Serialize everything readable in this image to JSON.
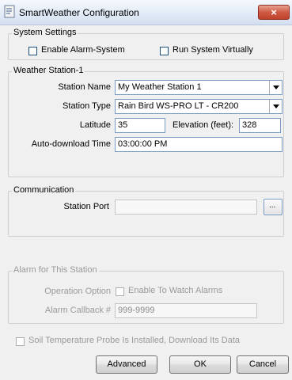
{
  "window": {
    "title": "SmartWeather Configuration",
    "close_icon": "×"
  },
  "system_settings": {
    "legend": "System Settings",
    "enable_alarm_system": {
      "label": "Enable Alarm-System",
      "checked": false
    },
    "run_virtually": {
      "label": "Run System Virtually",
      "checked": false
    }
  },
  "weather_station": {
    "legend": "Weather Station-1",
    "station_name_label": "Station Name",
    "station_name_value": "My Weather Station 1",
    "station_type_label": "Station Type",
    "station_type_value": "Rain Bird WS-PRO LT - CR200",
    "latitude_label": "Latitude",
    "latitude_value": "35",
    "elevation_label": "Elevation (feet):",
    "elevation_value": "328",
    "auto_download_label": "Auto-download Time",
    "auto_download_value": "03:00:00 PM"
  },
  "communication": {
    "legend": "Communication",
    "station_port_label": "Station Port",
    "station_port_value": "",
    "browse_glyph": "..."
  },
  "alarm": {
    "legend": "Alarm for This Station",
    "operation_option_label": "Operation Option",
    "enable_watch_label": "Enable To Watch Alarms",
    "callback_label": "Alarm Callback #",
    "callback_value": "999-9999"
  },
  "soil_probe": {
    "label": "Soil Temperature Probe Is Installed, Download Its Data",
    "checked": false
  },
  "buttons": {
    "advanced": "Advanced",
    "ok": "OK",
    "cancel": "Cancel"
  }
}
